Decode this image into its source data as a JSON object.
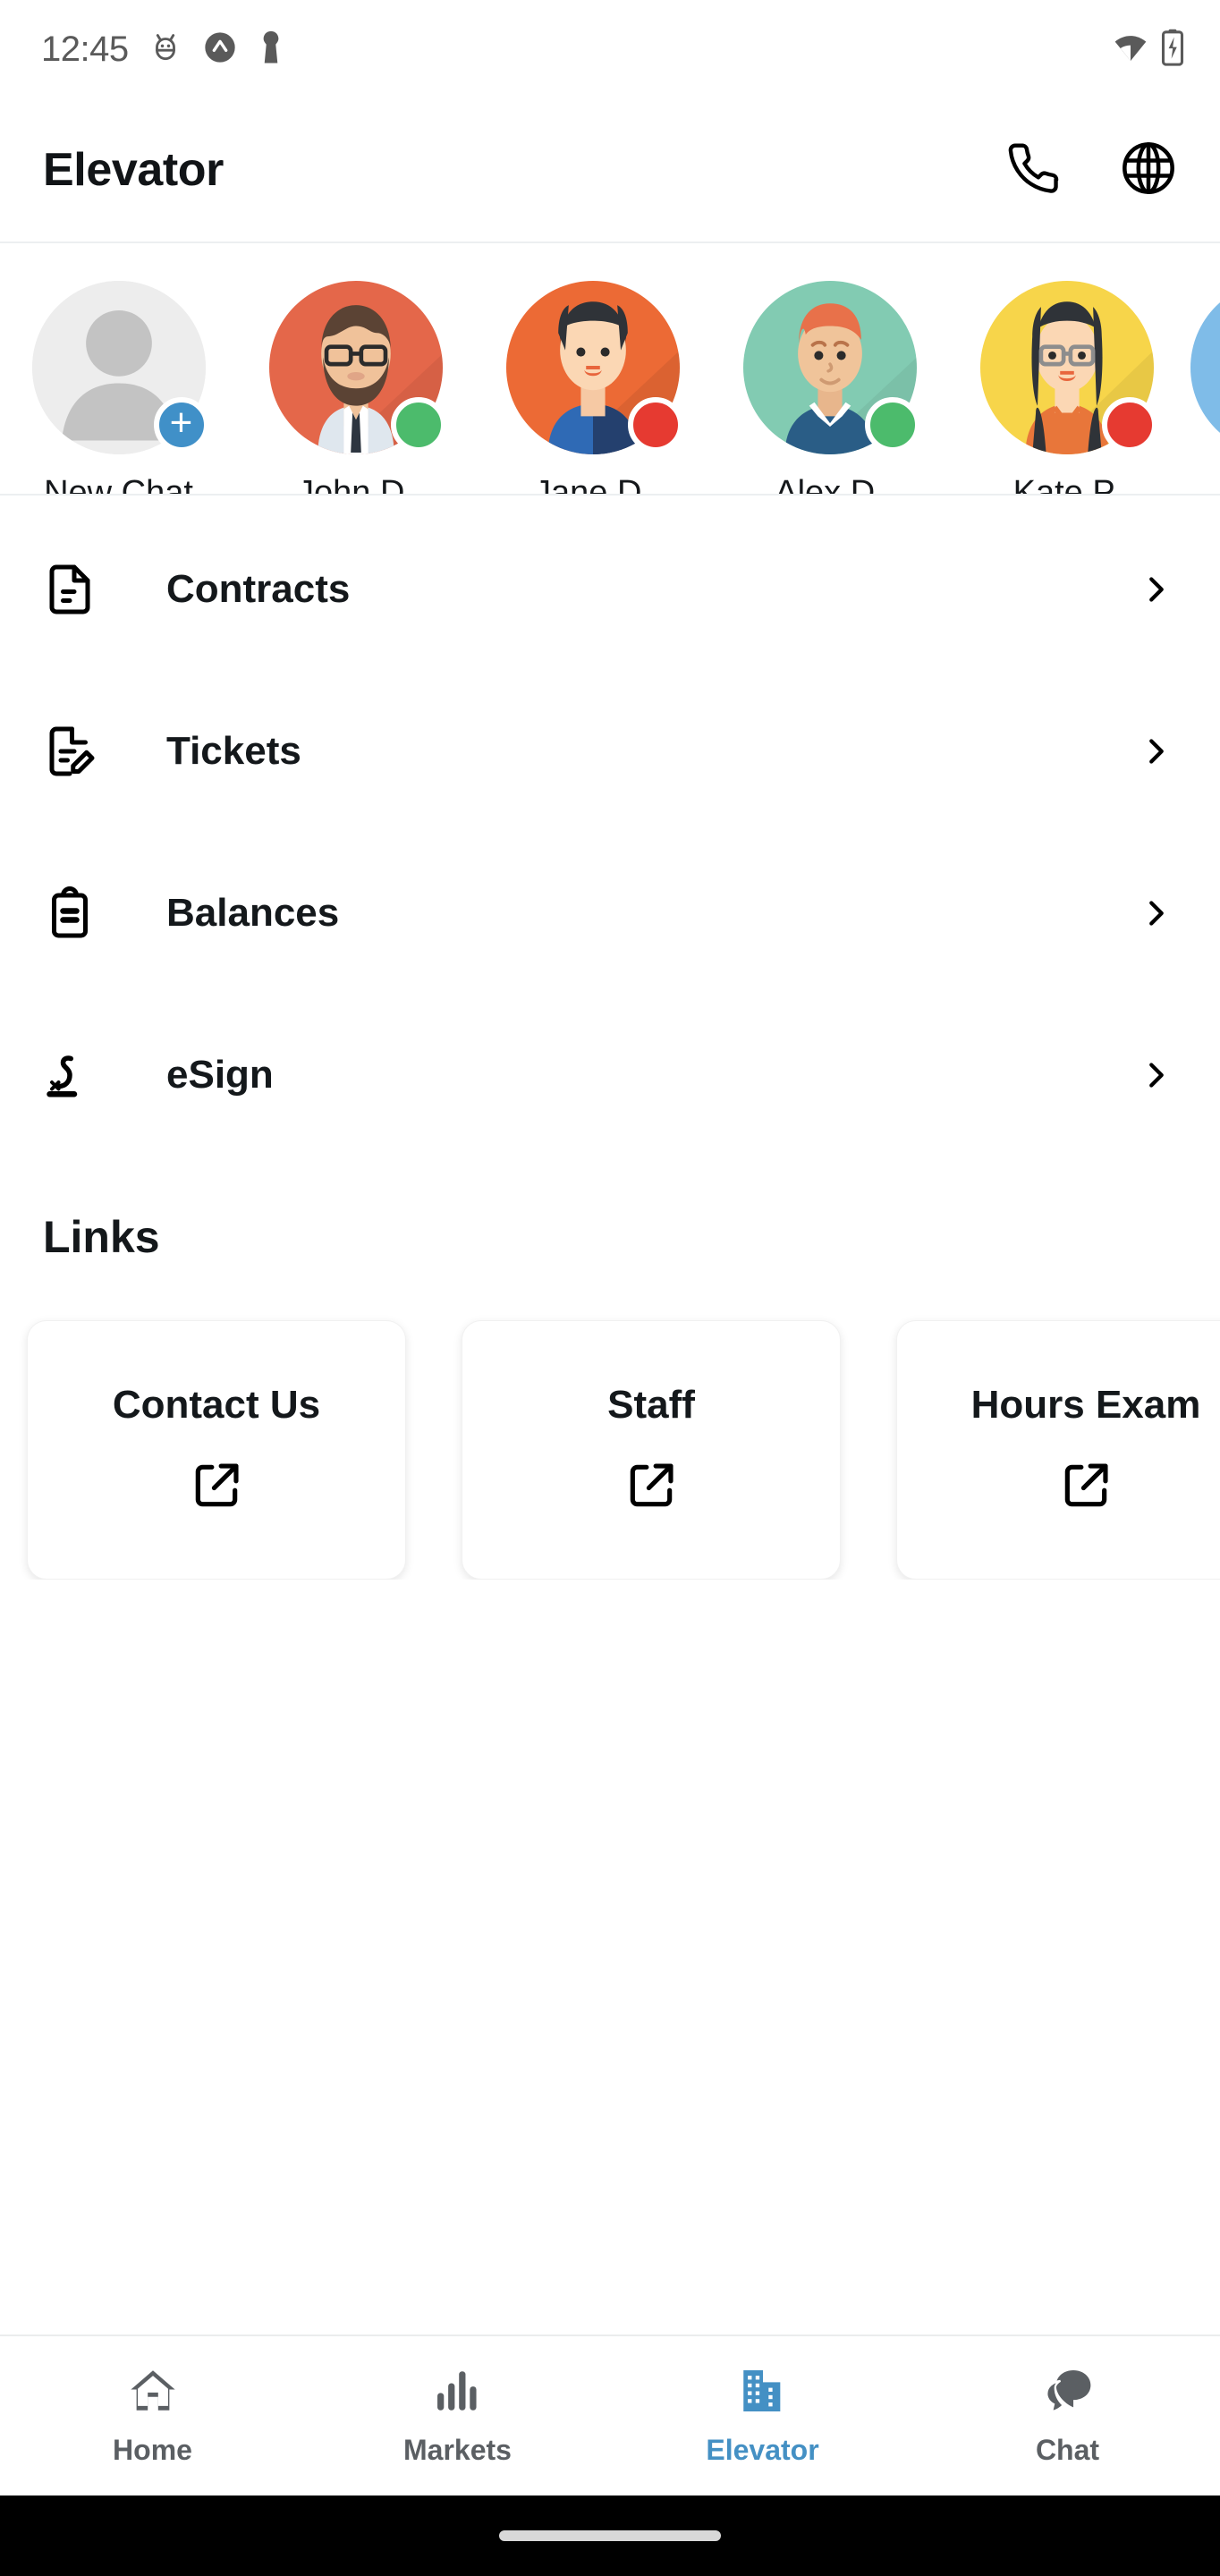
{
  "status_bar": {
    "time": "12:45",
    "left_icons": [
      "android-bug-icon",
      "caret-up-circle-icon",
      "keyhole-pin-icon"
    ],
    "right_icons": [
      "wifi-icon",
      "battery-charging-icon"
    ]
  },
  "app_bar": {
    "title": "Elevator",
    "actions": [
      {
        "name": "phone-icon",
        "label": "Call"
      },
      {
        "name": "globe-icon",
        "label": "Language"
      }
    ]
  },
  "contacts": {
    "items": [
      {
        "label": "New Chat",
        "type": "new",
        "badge": "plus",
        "badge_color": "#4090c8",
        "bg": "#ededed"
      },
      {
        "label": "John D.",
        "type": "person",
        "badge": "status",
        "badge_color": "#4cbb6c",
        "bg": "#e4674a"
      },
      {
        "label": "Jane D.",
        "type": "person",
        "badge": "status",
        "badge_color": "#e63a31",
        "bg": "#ec6a35"
      },
      {
        "label": "Alex D.",
        "type": "person",
        "badge": "status",
        "badge_color": "#4cbb6c",
        "bg": "#82cbb2"
      },
      {
        "label": "Kate P.",
        "type": "person",
        "badge": "status",
        "badge_color": "#e63a31",
        "bg": "#f7d54a"
      },
      {
        "label": "",
        "type": "partial",
        "badge": "none",
        "badge_color": "",
        "bg": "#7fbce8"
      }
    ]
  },
  "menu": {
    "items": [
      {
        "label": "Contracts",
        "icon": "document-icon",
        "chevron": "chevron-right-icon"
      },
      {
        "label": "Tickets",
        "icon": "document-edit-icon",
        "chevron": "chevron-right-icon"
      },
      {
        "label": "Balances",
        "icon": "clipboard-icon",
        "chevron": "chevron-right-icon"
      },
      {
        "label": "eSign",
        "icon": "signature-icon",
        "chevron": "chevron-right-icon"
      }
    ]
  },
  "links": {
    "heading": "Links",
    "cards": [
      {
        "title": "Contact Us",
        "icon": "external-link-icon"
      },
      {
        "title": "Staff",
        "icon": "external-link-icon"
      },
      {
        "title": "Hours Exam",
        "icon": "external-link-icon"
      }
    ]
  },
  "bottom_nav": {
    "active_color": "#4490c4",
    "inactive_color": "#5b5f63",
    "items": [
      {
        "label": "Home",
        "icon": "home-icon",
        "active": false
      },
      {
        "label": "Markets",
        "icon": "bar-chart-icon",
        "active": false
      },
      {
        "label": "Elevator",
        "icon": "building-icon",
        "active": true
      },
      {
        "label": "Chat",
        "icon": "chat-bubbles-icon",
        "active": false
      }
    ]
  }
}
